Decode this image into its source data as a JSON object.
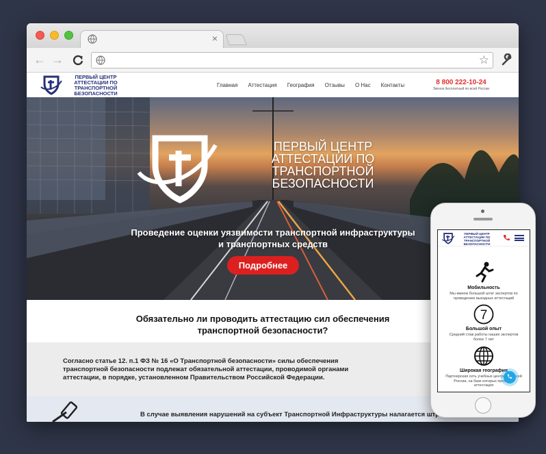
{
  "browser": {
    "tab_title": "",
    "url": "",
    "tab_close": "×",
    "back_glyph": "←",
    "forward_glyph": "→",
    "reload_glyph": "C",
    "star_glyph": "☆"
  },
  "site": {
    "logo_text": "Первый центр аттестации по транспортной безопасности",
    "nav": [
      "Главная",
      "Аттестация",
      "География",
      "Отзывы",
      "О Нас",
      "Контакты"
    ],
    "phone": "8 800 222-10-24",
    "phone_note": "Звонок бесплатный по всей России"
  },
  "hero": {
    "title": "Первый центр аттестации по транспортной безопасности",
    "subtitle": "Проведение оценки уязвимости транспортной инфраструктуры и транспортных средств",
    "button": "Подробнее"
  },
  "question": {
    "heading": "Обязательно ли проводить аттестацию сил обеспечения транспортной безопасности?"
  },
  "law": {
    "text": "Согласно статье 12. п.1 ФЗ № 16 «О Транспортной безопасности» силы обеспечения транспортной безопасности подлежат обязательной аттестации, проводимой органами аттестации, в порядке, установленном Правительством Российской Федерации."
  },
  "violation": {
    "text": "В случае выявления нарушений на субъект Транспортной Инфраструктуры налагается штраф"
  },
  "mobile": {
    "logo_text": "Первый центр аттестации по транспортной безопасности",
    "features": [
      {
        "icon": "running-man-icon",
        "title": "Мобильность",
        "desc": "Мы имеем большой штат экспертов по проведению выездных аттестаций"
      },
      {
        "icon": "seven-circle-icon",
        "icon_text": "7",
        "title": "Большой опыт",
        "desc": "Средний стаж работы наших экспертов более 7 лет"
      },
      {
        "icon": "globe-icon",
        "title": "Широкая география",
        "desc": "Партнерская сеть учебных центров по всей России, на базе которых проходят аттестация"
      }
    ]
  },
  "colors": {
    "accent_red": "#dc2020",
    "brand_blue": "#26307a",
    "call_blue": "#23a6e6",
    "backdrop": "#2f3548"
  }
}
